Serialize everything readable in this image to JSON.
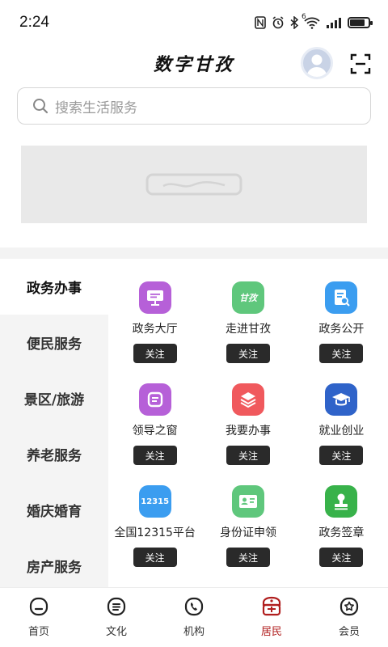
{
  "status_bar": {
    "time": "2:24",
    "network_label": "6"
  },
  "header": {
    "title": "数字甘孜"
  },
  "search": {
    "placeholder": "搜索生活服务"
  },
  "categories": [
    {
      "label": "政务办事",
      "active": true
    },
    {
      "label": "便民服务",
      "active": false
    },
    {
      "label": "景区/旅游",
      "active": false
    },
    {
      "label": "养老服务",
      "active": false
    },
    {
      "label": "婚庆婚育",
      "active": false
    },
    {
      "label": "房产服务",
      "active": false
    }
  ],
  "services": [
    {
      "name": "政务大厅",
      "follow": "关注",
      "icon": "monitor-icon",
      "color": "#b660d8"
    },
    {
      "name": "走进甘孜",
      "follow": "关注",
      "icon": "ganzi-logo-icon",
      "icon_text": "甘孜",
      "color": "#5fc77c"
    },
    {
      "name": "政务公开",
      "follow": "关注",
      "icon": "document-search-icon",
      "color": "#3b9df0"
    },
    {
      "name": "领导之窗",
      "follow": "关注",
      "icon": "window-icon",
      "color": "#b660d8"
    },
    {
      "name": "我要办事",
      "follow": "关注",
      "icon": "layers-icon",
      "color": "#f0595d"
    },
    {
      "name": "就业创业",
      "follow": "关注",
      "icon": "graduation-cap-icon",
      "color": "#2f63c9"
    },
    {
      "name": "全国12315平台",
      "follow": "关注",
      "icon": "complaint-12315-icon",
      "icon_text": "12315",
      "color": "#3b9df0"
    },
    {
      "name": "身份证申领",
      "follow": "关注",
      "icon": "id-card-icon",
      "color": "#5fc77c"
    },
    {
      "name": "政务签章",
      "follow": "关注",
      "icon": "stamp-icon",
      "color": "#38b24a"
    }
  ],
  "tabs": [
    {
      "label": "首页",
      "icon": "home-icon",
      "active": false
    },
    {
      "label": "文化",
      "icon": "culture-icon",
      "active": false
    },
    {
      "label": "机构",
      "icon": "phone-icon",
      "active": false
    },
    {
      "label": "居民",
      "icon": "resident-icon",
      "active": true
    },
    {
      "label": "会员",
      "icon": "member-star-icon",
      "active": false
    }
  ],
  "colors": {
    "accent": "#b01e1e",
    "follow_button": "#2a2a2a"
  }
}
